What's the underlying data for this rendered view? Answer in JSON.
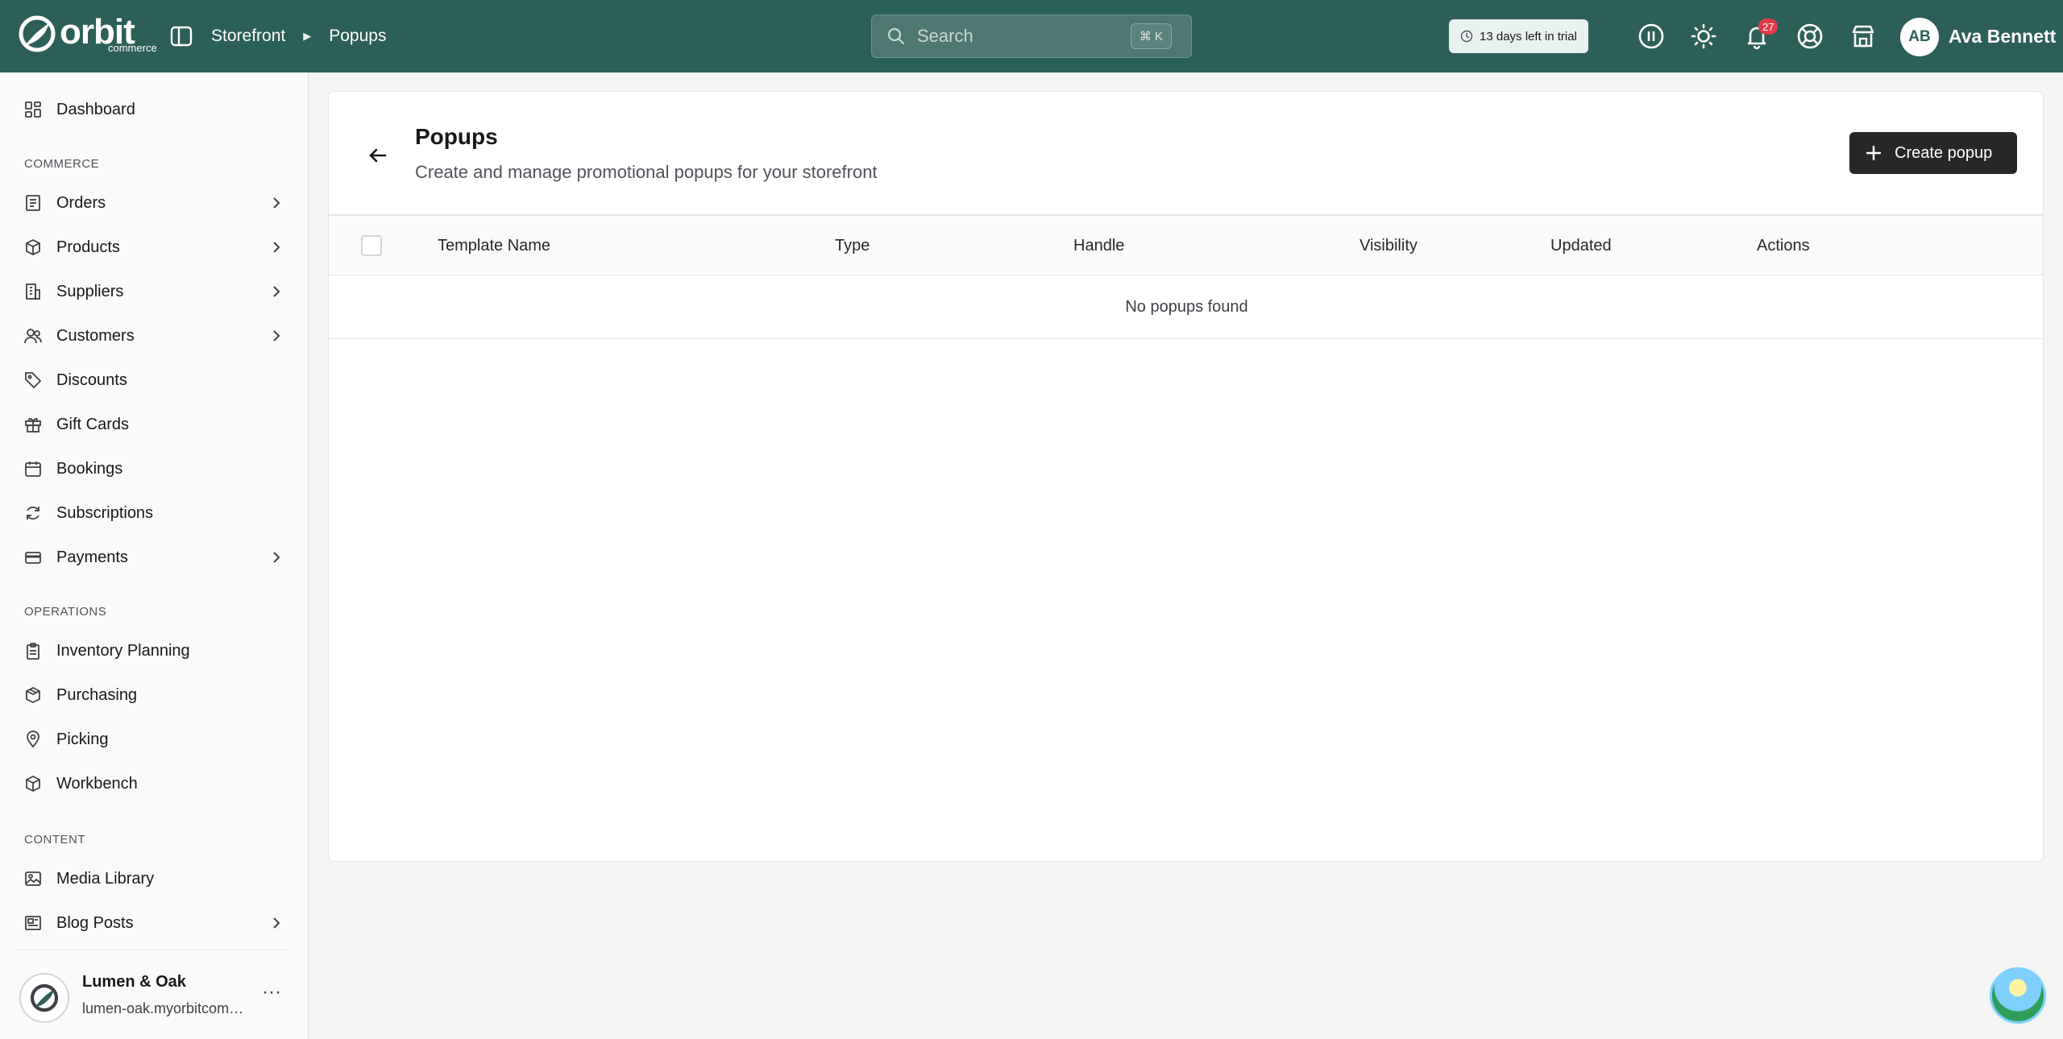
{
  "topbar": {
    "logo_text": "orbit",
    "logo_sub": "commerce",
    "breadcrumb": [
      "Storefront",
      "Popups"
    ],
    "search_placeholder": "Search",
    "search_shortcut": "⌘ K",
    "trial_text": "13 days left in trial",
    "notification_count": "27",
    "user_initials": "AB",
    "user_name": "Ava Bennett"
  },
  "sidebar": {
    "items": [
      {
        "label": "Dashboard"
      },
      {
        "label": "Orders"
      },
      {
        "label": "Products"
      },
      {
        "label": "Suppliers"
      },
      {
        "label": "Customers"
      },
      {
        "label": "Discounts"
      },
      {
        "label": "Gift Cards"
      },
      {
        "label": "Bookings"
      },
      {
        "label": "Subscriptions"
      },
      {
        "label": "Payments"
      },
      {
        "label": "Inventory Planning"
      },
      {
        "label": "Purchasing"
      },
      {
        "label": "Picking"
      },
      {
        "label": "Workbench"
      },
      {
        "label": "Media Library"
      },
      {
        "label": "Blog Posts"
      }
    ],
    "sections": [
      "COMMERCE",
      "OPERATIONS",
      "CONTENT"
    ],
    "store": {
      "name": "Lumen & Oak",
      "url": "lumen-oak.myorbitcommerce.com"
    }
  },
  "page": {
    "title": "Popups",
    "subtitle": "Create and manage promotional popups for your storefront",
    "create_label": "Create popup",
    "columns": [
      "Template Name",
      "Type",
      "Handle",
      "Visibility",
      "Updated",
      "Actions"
    ],
    "empty_text": "No popups found"
  },
  "colors": {
    "topbar": "#2c5f57",
    "primary_button": "#27272a",
    "badge": "#e23b4a"
  }
}
